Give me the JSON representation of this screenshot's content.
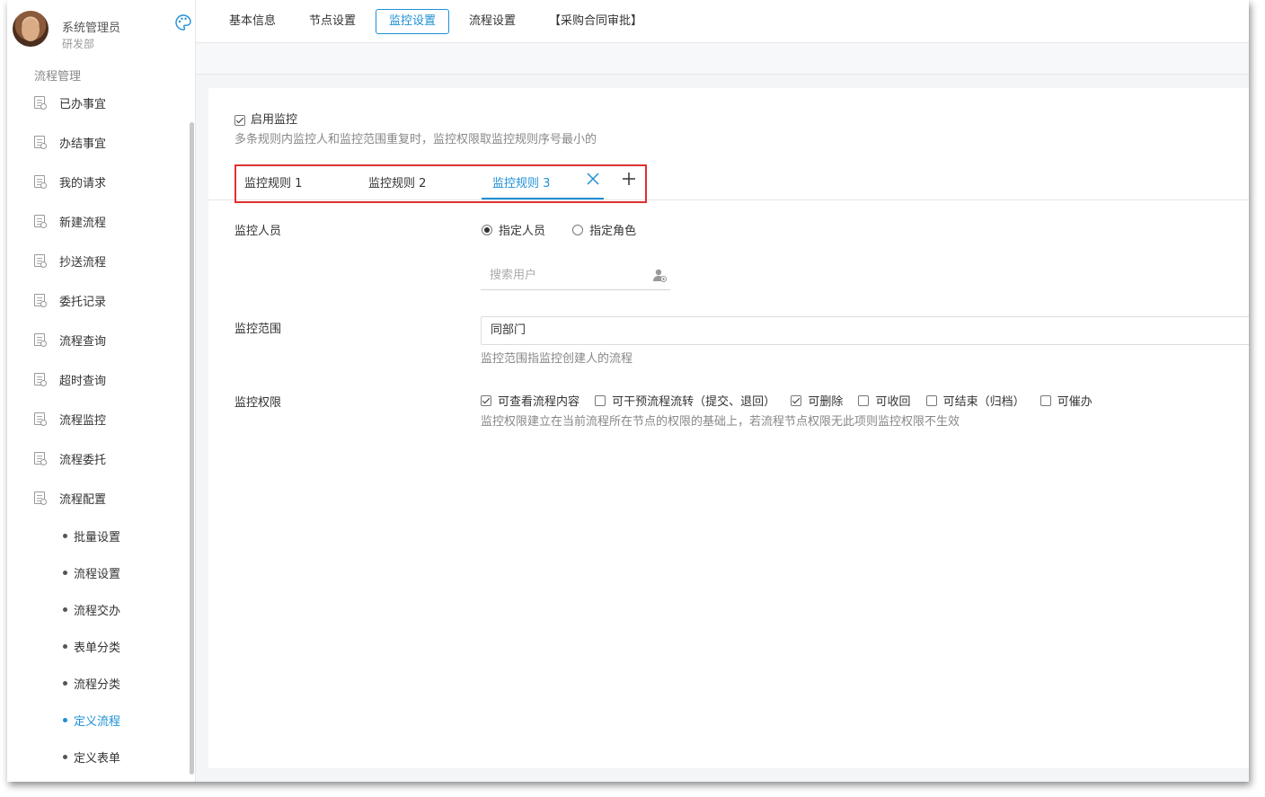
{
  "user": {
    "name": "系统管理员",
    "dept": "研发部"
  },
  "sidebar": {
    "section_title": "流程管理",
    "items": [
      {
        "label": "已办事宜"
      },
      {
        "label": "办结事宜"
      },
      {
        "label": "我的请求"
      },
      {
        "label": "新建流程"
      },
      {
        "label": "抄送流程"
      },
      {
        "label": "委托记录"
      },
      {
        "label": "流程查询"
      },
      {
        "label": "超时查询"
      },
      {
        "label": "流程监控"
      },
      {
        "label": "流程委托"
      },
      {
        "label": "流程配置"
      }
    ],
    "sub_items": [
      {
        "label": "批量设置"
      },
      {
        "label": "流程设置"
      },
      {
        "label": "流程交办"
      },
      {
        "label": "表单分类"
      },
      {
        "label": "流程分类"
      },
      {
        "label": "定义流程",
        "active": true
      },
      {
        "label": "定义表单"
      }
    ]
  },
  "tabs": [
    {
      "label": "基本信息"
    },
    {
      "label": "节点设置"
    },
    {
      "label": "监控设置",
      "active": true
    },
    {
      "label": "流程设置"
    },
    {
      "label": "【采购合同审批】"
    }
  ],
  "monitor": {
    "enable_label": "启用监控",
    "enable_checked": true,
    "enable_hint": "多条规则内监控人和监控范围重复时，监控权限取监控规则序号最小的",
    "rule_tabs": [
      {
        "label": "监控规则 1"
      },
      {
        "label": "监控规则 2"
      },
      {
        "label": "监控规则 3",
        "active": true
      }
    ],
    "person_label": "监控人员",
    "person_options": [
      {
        "label": "指定人员",
        "checked": true
      },
      {
        "label": "指定角色",
        "checked": false
      }
    ],
    "search_placeholder": "搜索用户",
    "scope_label": "监控范围",
    "scope_value": "同部门",
    "scope_hint": "监控范围指监控创建人的流程",
    "perm_label": "监控权限",
    "perm_options": [
      {
        "label": "可查看流程内容",
        "checked": true
      },
      {
        "label": "可干预流程流转（提交、退回）",
        "checked": false
      },
      {
        "label": "可删除",
        "checked": true
      },
      {
        "label": "可收回",
        "checked": false
      },
      {
        "label": "可结束（归档）",
        "checked": false
      },
      {
        "label": "可催办",
        "checked": false
      }
    ],
    "perm_hint": "监控权限建立在当前流程所在节点的权限的基础上，若流程节点权限无此项则监控权限不生效"
  },
  "colors": {
    "accent": "#1e90d6",
    "highlight": "#e03030"
  }
}
